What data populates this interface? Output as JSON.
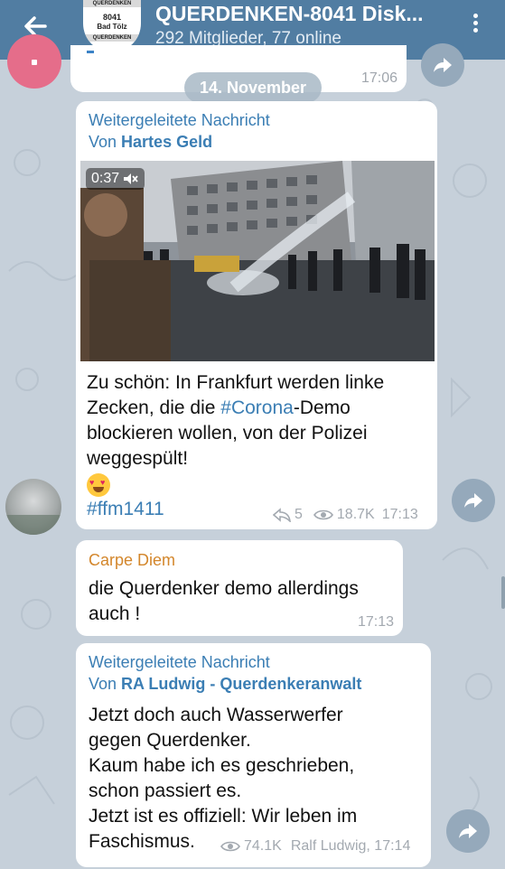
{
  "header": {
    "title": "QUERDENKEN-8041 Disk...",
    "subtitle": "292 Mitglieder, 77 online",
    "avatar_lines": [
      "QUERDENKEN",
      "8041",
      "Bad Tölz",
      "QUERDENKEN"
    ]
  },
  "previous_message": {
    "time": "17:06"
  },
  "date_separator": "14. November",
  "messages": [
    {
      "forward_label": "Weitergeleitete Nachricht",
      "forward_prefix": "Von ",
      "forward_from": "Hartes Geld",
      "video_duration": "0:37",
      "text_before_tag": "Zu schön: In Frankfurt werden linke Zecken, die die ",
      "hashtag_inline": "#Corona",
      "text_after_tag": "-Demo blockieren wollen, von der Polizei weggespült!",
      "hashtag_footer": "#ffm1411",
      "share_count": "5",
      "views": "18.7K",
      "time": "17:13"
    },
    {
      "sender": "Carpe Diem",
      "text": "die Querdenker demo allerdings auch !",
      "time": "17:13"
    },
    {
      "forward_label": "Weitergeleitete Nachricht",
      "forward_prefix": "Von ",
      "forward_from": "RA Ludwig - Querdenkeranwalt",
      "lines": [
        "Jetzt doch auch Wasserwerfer",
        "gegen Querdenker.",
        "Kaum habe ich es geschrieben,",
        "schon passiert es.",
        "Jetzt ist es offiziell: Wir leben im",
        "Faschismus."
      ],
      "views": "74.1K",
      "signature_time": "Ralf Ludwig, 17:14"
    }
  ],
  "icons": [
    "back-arrow-icon",
    "more-vert-icon",
    "forward-icon",
    "muted-icon",
    "share-icon",
    "eye-icon",
    "emoji-heart-eyes-icon"
  ],
  "colors": {
    "header": "#517da2",
    "link": "#3b7eb4",
    "sender_name": "#d3862b",
    "chat_bg": "#c6d0da"
  }
}
